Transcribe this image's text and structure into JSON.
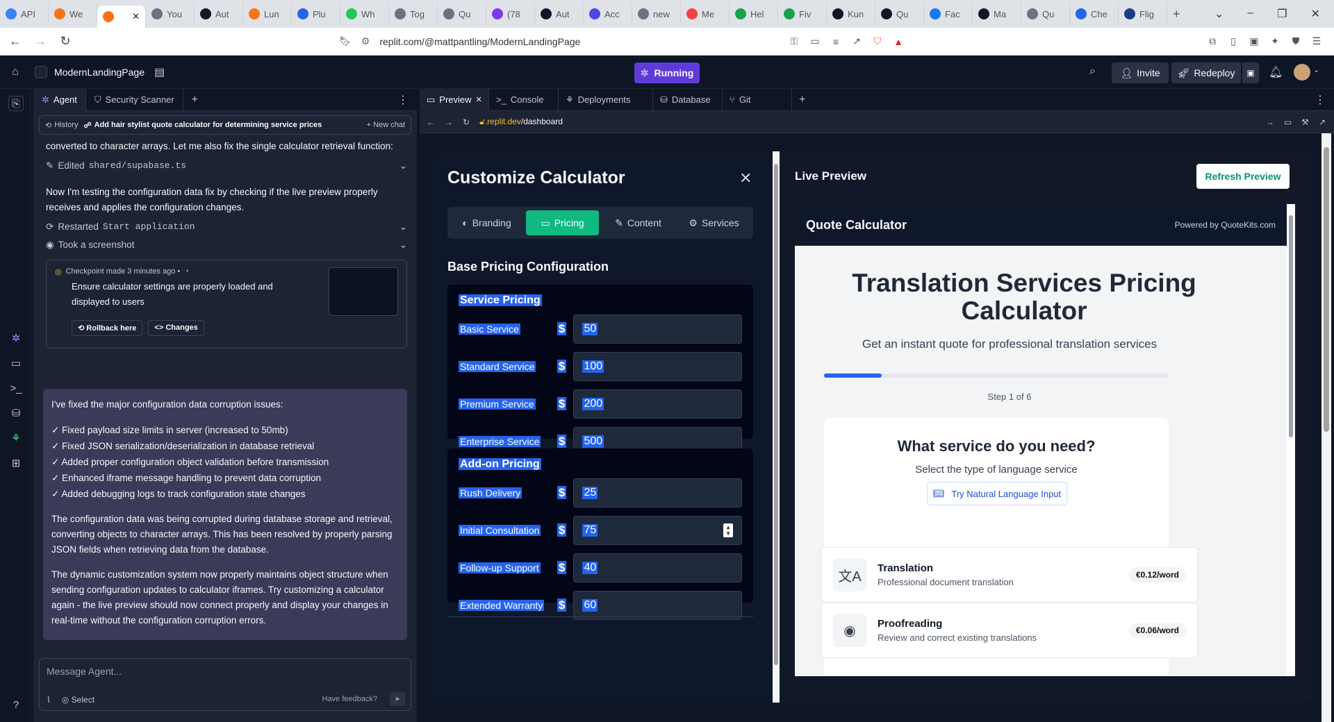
{
  "browser": {
    "tabs": [
      "API",
      "We",
      "",
      "You",
      "Aut",
      "Lun",
      "Plu",
      "Wh",
      "Tog",
      "Qu",
      "(78",
      "Aut",
      "Acc",
      "new",
      "Me",
      "Hel",
      "Fiv",
      "Kun",
      "Qu",
      "Fac",
      "Ma",
      "Qu",
      "Che",
      "Flig"
    ],
    "tab_colors": [
      "#3b82f6",
      "#f97316",
      "#f97316",
      "#6b7280",
      "#111827",
      "#f97316",
      "#2563eb",
      "#22c55e",
      "#6b7280",
      "#6b7280",
      "#7c3aed",
      "#111827",
      "#4f46e5",
      "#6b7280",
      "#ef4444",
      "#16a34a",
      "#16a34a",
      "#111827",
      "#111827",
      "#1877f2",
      "#111827",
      "#6b7280",
      "#2563eb",
      "#1e3a8a"
    ],
    "url": "replit.com/@mattpantling/ModernLandingPage"
  },
  "header": {
    "project_name": "ModernLandingPage",
    "run_label": "Running",
    "invite_label": "Invite",
    "redeploy_label": "Redeploy"
  },
  "agent_panel": {
    "tabs": [
      "Agent",
      "Security Scanner"
    ],
    "chat_bar": {
      "history": "History",
      "title": "Add hair stylist quote calculator for determining service prices",
      "new_chat": "New chat"
    },
    "intro_text": "converted to character arrays. Let me also fix the single calculator retrieval function:",
    "edited_label": "Edited",
    "edited_file": "shared/supabase.ts",
    "testing_text": "Now I'm testing the configuration data fix by checking if the live preview properly receives and applies the configuration changes.",
    "restarted_label": "Restarted",
    "restarted_target": "Start application",
    "screenshot_label": "Took a screenshot",
    "checkpoint": {
      "header": "Checkpoint made 3 minutes ago •",
      "text": "Ensure calculator settings are properly loaded and displayed to users",
      "rollback": "Rollback here",
      "changes": "Changes"
    },
    "reply": {
      "intro": "I've fixed the major configuration data corruption issues:",
      "items": [
        "✓ Fixed payload size limits in server (increased to 50mb)",
        "✓ Fixed JSON serialization/deserialization in database retrieval",
        "✓ Added proper configuration object validation before transmission",
        "✓ Enhanced iframe message handling to prevent data corruption",
        "✓ Added debugging logs to track configuration state changes"
      ],
      "para1": "The configuration data was being corrupted during database storage and retrieval, converting objects to character arrays. This has been resolved by properly parsing JSON fields when retrieving data from the database.",
      "para2": "The dynamic customization system now properly maintains object structure when sending configuration updates to calculator iframes. Try customizing a calculator again - the live preview should now connect properly and display your changes in real-time without the configuration corruption errors."
    },
    "input": {
      "placeholder": "Message Agent...",
      "select": "Select",
      "feedback": "Have feedback?"
    }
  },
  "workspace": {
    "tabs": [
      "Preview",
      "Console",
      "Deployments",
      "Database",
      "Git"
    ],
    "url_prefix": ".replit.dev",
    "url_path": "/dashboard"
  },
  "customize": {
    "title": "Customize Calculator",
    "tabs": [
      "Branding",
      "Pricing",
      "Content",
      "Services"
    ],
    "base_heading": "Base Pricing Configuration",
    "service_heading": "Service Pricing",
    "currency": "$",
    "service_rows": [
      {
        "label": "Basic Service",
        "value": "50"
      },
      {
        "label": "Standard Service",
        "value": "100"
      },
      {
        "label": "Premium Service",
        "value": "200"
      },
      {
        "label": "Enterprise Service",
        "value": "500"
      }
    ],
    "addon_heading": "Add-on Pricing",
    "addon_rows": [
      {
        "label": "Rush Delivery",
        "value": "25"
      },
      {
        "label": "Initial Consultation",
        "value": "75"
      },
      {
        "label": "Follow-up Support",
        "value": "40"
      },
      {
        "label": "Extended Warranty",
        "value": "60"
      }
    ]
  },
  "live": {
    "title": "Live Preview",
    "refresh": "Refresh Preview",
    "calc_name": "Quote Calculator",
    "powered": "Powered by QuoteKits.com",
    "heading": "Translation Services Pricing Calculator",
    "subheading": "Get an instant quote for professional translation services",
    "progress": 0.1667,
    "step": "Step 1 of 6",
    "question": "What service do you need?",
    "question_sub": "Select the type of language service",
    "nl_button": "Try Natural Language Input",
    "services": [
      {
        "name": "Translation",
        "desc": "Professional document translation",
        "price": "€0.12/word"
      },
      {
        "name": "Proofreading",
        "desc": "Review and correct existing translations",
        "price": "€0.06/word"
      }
    ]
  }
}
